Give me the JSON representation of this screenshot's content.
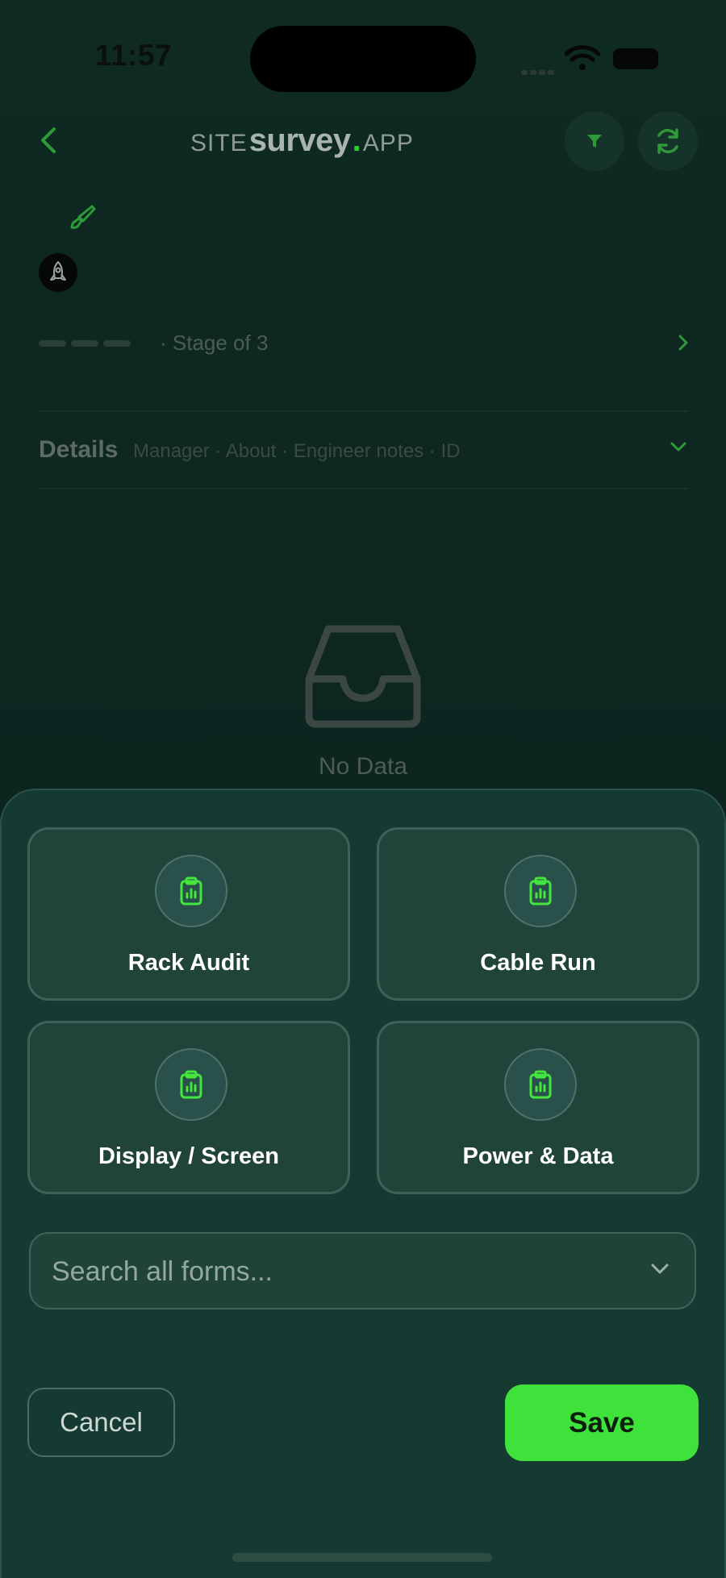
{
  "status": {
    "time": "11:57"
  },
  "header": {
    "logo_prefix": "SITE",
    "logo_main": "survey",
    "logo_dot": ".",
    "logo_suffix": "APP"
  },
  "stage": {
    "text": "· Stage  of 3"
  },
  "details": {
    "title": "Details",
    "subtitle": "Manager · About · Engineer notes · ID"
  },
  "empty": {
    "text": "No Data"
  },
  "sheet": {
    "forms": [
      {
        "label": "Rack Audit",
        "icon": "clipboard-chart-icon"
      },
      {
        "label": "Cable Run",
        "icon": "clipboard-chart-icon"
      },
      {
        "label": "Display / Screen",
        "icon": "clipboard-chart-icon"
      },
      {
        "label": "Power & Data",
        "icon": "clipboard-chart-icon"
      }
    ],
    "search_placeholder": "Search all forms...",
    "cancel_label": "Cancel",
    "save_label": "Save"
  },
  "colors": {
    "accent": "#3fe23a",
    "icon_green": "#2fa83a",
    "sheet_bg": "#153a31",
    "page_bg": "#0e241d"
  }
}
